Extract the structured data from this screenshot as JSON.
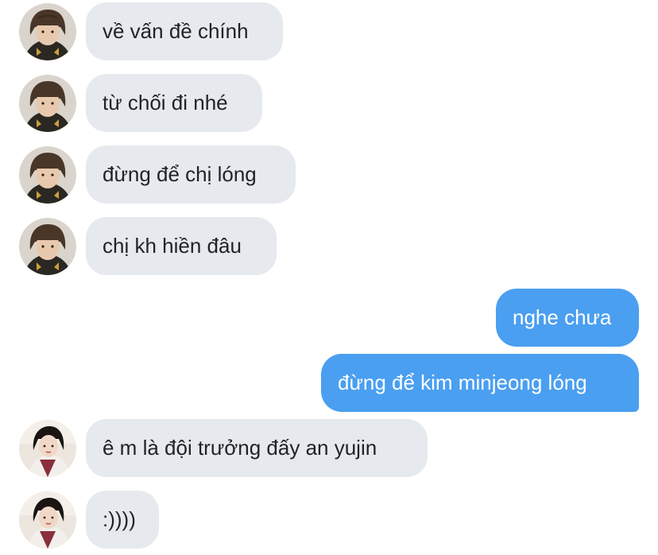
{
  "messages": [
    {
      "side": "in",
      "text": "về vấn đề chính",
      "avatar": "user-a-avatar"
    },
    {
      "side": "in",
      "text": "từ chối đi nhé",
      "avatar": "user-a-avatar"
    },
    {
      "side": "in",
      "text": "đừng để chị lóng",
      "avatar": "user-a-avatar"
    },
    {
      "side": "in",
      "text": "chị kh hiền đâu",
      "avatar": "user-a-avatar"
    },
    {
      "side": "out",
      "text": "nghe chưa"
    },
    {
      "side": "out",
      "text": "đừng để kim minjeong lóng"
    },
    {
      "side": "in",
      "text": "ê m là đội trưởng đấy an yujin",
      "avatar": "user-b-avatar"
    },
    {
      "side": "in",
      "text": ":))))",
      "avatar": "user-b-avatar"
    }
  ],
  "colors": {
    "incoming_bubble": "#e6e9ee",
    "outgoing_bubble": "#4a9ff0",
    "incoming_text": "#1f2328",
    "outgoing_text": "#ffffff"
  }
}
